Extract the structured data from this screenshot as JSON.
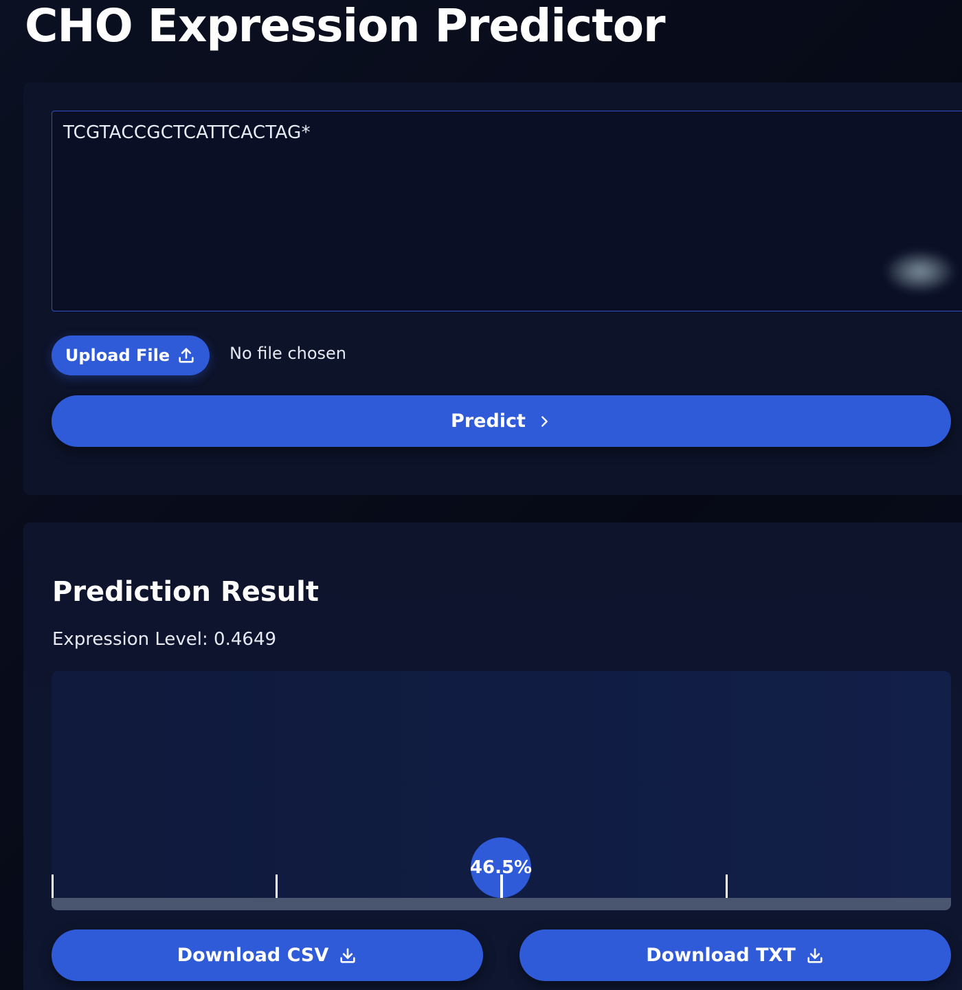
{
  "app": {
    "title": "CHO Expression Predictor"
  },
  "input": {
    "sequence_value": "TCGTACCGCTCATTCACTAG*",
    "upload_label": "Upload File",
    "file_status": "No file chosen",
    "predict_label": "Predict"
  },
  "result": {
    "heading": "Prediction Result",
    "expression_label": "Expression Level: 0.4649",
    "gauge": {
      "value_percent": 46.5,
      "value_label": "46.5%",
      "tick_fractions": [
        0,
        0.25,
        0.5,
        0.75
      ]
    },
    "download_csv_label": "Download CSV",
    "download_txt_label": "Download TXT"
  },
  "icons": {
    "upload": "upload-icon",
    "chevron": "chevron-right-icon",
    "download": "download-icon"
  },
  "colors": {
    "accent": "#2f5bd9",
    "background": "#070b1a",
    "card": "#0d1329",
    "track": "#4a5570"
  }
}
